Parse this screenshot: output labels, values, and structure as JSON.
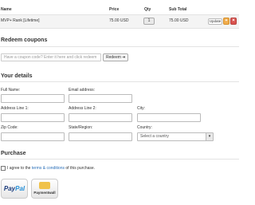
{
  "cart": {
    "headers": {
      "name": "Name",
      "price": "Price",
      "qty": "Qty",
      "subtotal": "Sub Total"
    },
    "item": {
      "name": "MVP+ Rank [Lifetime]",
      "price": "75.00 USD",
      "qty": "1",
      "subtotal": "75.00 USD",
      "update_label": "Update",
      "gear_icon": "gear-icon",
      "remove_icon": "remove-icon"
    }
  },
  "coupons": {
    "title": "Redeem coupons",
    "placeholder": "Have a coupon code? Enter it here and click redeem",
    "button_label": "Redeem ➜"
  },
  "details": {
    "title": "Your details",
    "full_name": "Full Name:",
    "email": "Email address:",
    "address1": "Address Line 1:",
    "address2": "Address Line 2:",
    "city": "City:",
    "zip": "Zip Code:",
    "state": "State/Region:",
    "country": "Country:",
    "country_selected": "Select a country"
  },
  "purchase": {
    "title": "Purchase",
    "agree_prefix": "I agree to the ",
    "agree_link": "terms & conditions",
    "agree_suffix": " of this purchase.",
    "paypal_part1": "Pay",
    "paypal_part2": "Pal",
    "paymentwall": "Paymentwall"
  },
  "colors": {
    "gear": "#f0ad4e",
    "remove": "#d9534f",
    "link": "#2a6fb8"
  }
}
